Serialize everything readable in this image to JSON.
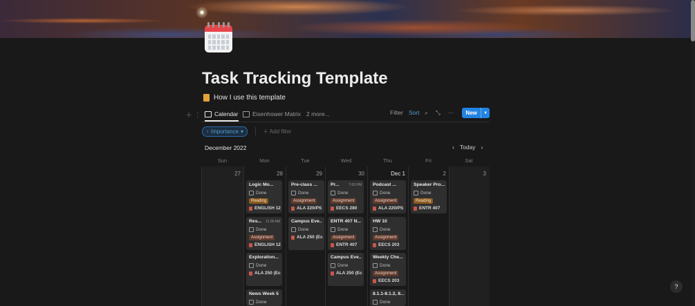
{
  "page": {
    "title": "Task Tracking Template",
    "howto": "How I use this template"
  },
  "views": {
    "tabs": [
      "Calendar",
      "Eisenhower Matrix",
      "2 more..."
    ],
    "filter": "Filter",
    "sort": "Sort",
    "new": "New"
  },
  "filters": {
    "importance": "Importance",
    "add": "Add filter"
  },
  "calendar": {
    "month": "December 2022",
    "today": "Today",
    "weekdays": [
      "Sun",
      "Mon",
      "Tue",
      "Wed",
      "Thu",
      "Fri",
      "Sat"
    ],
    "days": [
      "27",
      "28",
      "29",
      "30",
      "Dec 1",
      "2",
      "3"
    ]
  },
  "events": {
    "mon": [
      {
        "title": "Logic Mo...",
        "time": "",
        "done": "Done",
        "tag": "Reading",
        "course": "ENGLISH 12"
      },
      {
        "title": "Res...",
        "time": "11:30 AM",
        "done": "Done",
        "tag": "Assignment",
        "course": "ENGLISH 12"
      },
      {
        "title": "Exploration...",
        "time": "",
        "done": "Done",
        "tag": "",
        "course": "ALA 250 (Ec"
      },
      {
        "title": "News Week 5",
        "time": "",
        "done": "Done",
        "tag": "",
        "course": ""
      }
    ],
    "tue": [
      {
        "title": "Pre-class ...",
        "time": "",
        "done": "Done",
        "tag": "Assignment",
        "course": "ALA 220/PS"
      },
      {
        "title": "Campus Eve...",
        "time": "",
        "done": "Done",
        "tag": "",
        "course": "ALA 250 (Ec"
      }
    ],
    "wed": [
      {
        "title": "Pr...",
        "time": "7:00 PM",
        "done": "Done",
        "tag": "Assignment",
        "course": "EECS 280"
      },
      {
        "title": "ENTR 407 N...",
        "time": "",
        "done": "Done",
        "tag": "Assignment",
        "course": "ENTR 407"
      },
      {
        "title": "Campus Eve...",
        "time": "",
        "done": "Done",
        "tag": "",
        "course": "ALA 250 (Ec"
      }
    ],
    "thu": [
      {
        "title": "Podcast ...",
        "time": "",
        "done": "Done",
        "tag": "Assignment",
        "course": "ALA 220/PS"
      },
      {
        "title": "HW 10",
        "time": "",
        "done": "Done",
        "tag": "Assignment",
        "course": "EECS 203"
      },
      {
        "title": "Weekly Che...",
        "time": "",
        "done": "Done",
        "tag": "Assignment",
        "course": "EECS 203"
      },
      {
        "title": "8.1.1-8.1.2, 8....",
        "time": "",
        "done": "Done",
        "tag": "",
        "course": ""
      }
    ],
    "fri": [
      {
        "title": "Speaker Pro...",
        "time": "",
        "done": "Done",
        "tag": "Reading",
        "course": "ENTR 407"
      }
    ]
  },
  "help": "?"
}
